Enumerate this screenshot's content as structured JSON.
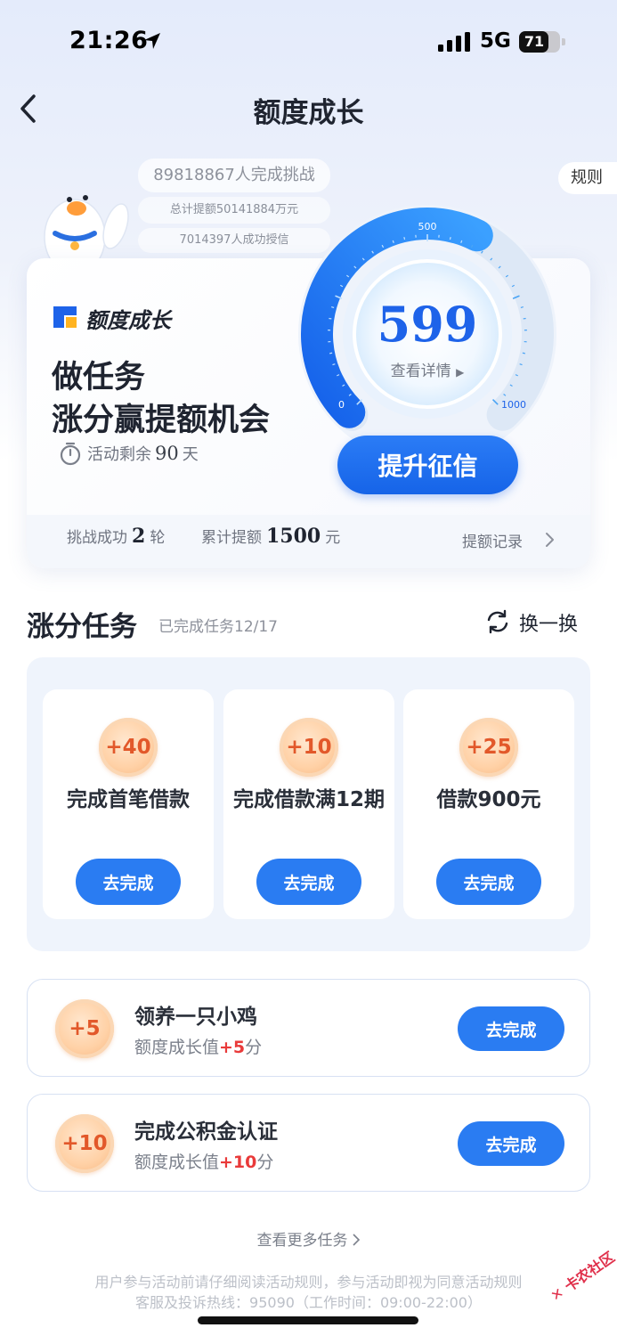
{
  "status_bar": {
    "time": "21:26",
    "network": "5G",
    "battery": "71",
    "battery_level": 0.71
  },
  "nav": {
    "title": "额度成长",
    "back_icon": "chevron-left-icon"
  },
  "stats": {
    "participants": "89818867人完成挑战",
    "total_increase": "总计提额50141884万元",
    "credited": "7014397人成功授信"
  },
  "rules_label": "规则",
  "card": {
    "brand_name": "额度成长",
    "headline_line1": "做任务",
    "headline_line2": "涨分赢提额机会",
    "remaining_label": "活动剩余",
    "remaining_days": "90",
    "remaining_unit": "天",
    "gauge": {
      "score": "599",
      "detail_label": "查看详情",
      "tick_min": "0",
      "tick_mid": "500",
      "tick_max": "1000",
      "range": [
        0,
        1000
      ],
      "value": 599
    },
    "boost_button": "提升征信",
    "success_label": "挑战成功",
    "success_count": "2",
    "success_unit": "轮",
    "total_label": "累计提额",
    "total_amount": "1500",
    "total_unit": "元",
    "record_link": "提额记录"
  },
  "tasks": {
    "title": "涨分任务",
    "progress": "已完成任务12/17",
    "refresh_label": "换一换",
    "grid": [
      {
        "points": "+40",
        "title": "完成首笔借款",
        "button": "去完成"
      },
      {
        "points": "+10",
        "title": "完成借款满12期",
        "button": "去完成"
      },
      {
        "points": "+25",
        "title": "借款900元",
        "button": "去完成"
      }
    ],
    "rows": [
      {
        "points": "+5",
        "title": "领养一只小鸡",
        "desc_prefix": "额度成长值",
        "desc_points": "+5",
        "desc_suffix": "分",
        "button": "去完成"
      },
      {
        "points": "+10",
        "title": "完成公积金认证",
        "desc_prefix": "额度成长值",
        "desc_points": "+10",
        "desc_suffix": "分",
        "button": "去完成"
      }
    ],
    "more_link": "查看更多任务"
  },
  "footer": {
    "notice1": "用户参与活动前请仔细阅读活动规则，参与活动即视为同意活动规则",
    "notice2": "客服及投诉热线：95090（工作时间：09:00-22:00）",
    "watermark": "卡农社区"
  },
  "colors": {
    "accent": "#1e63e9",
    "button": "#2a7cf2",
    "coin_text": "#e2582a",
    "points_red": "#e93a3a"
  }
}
